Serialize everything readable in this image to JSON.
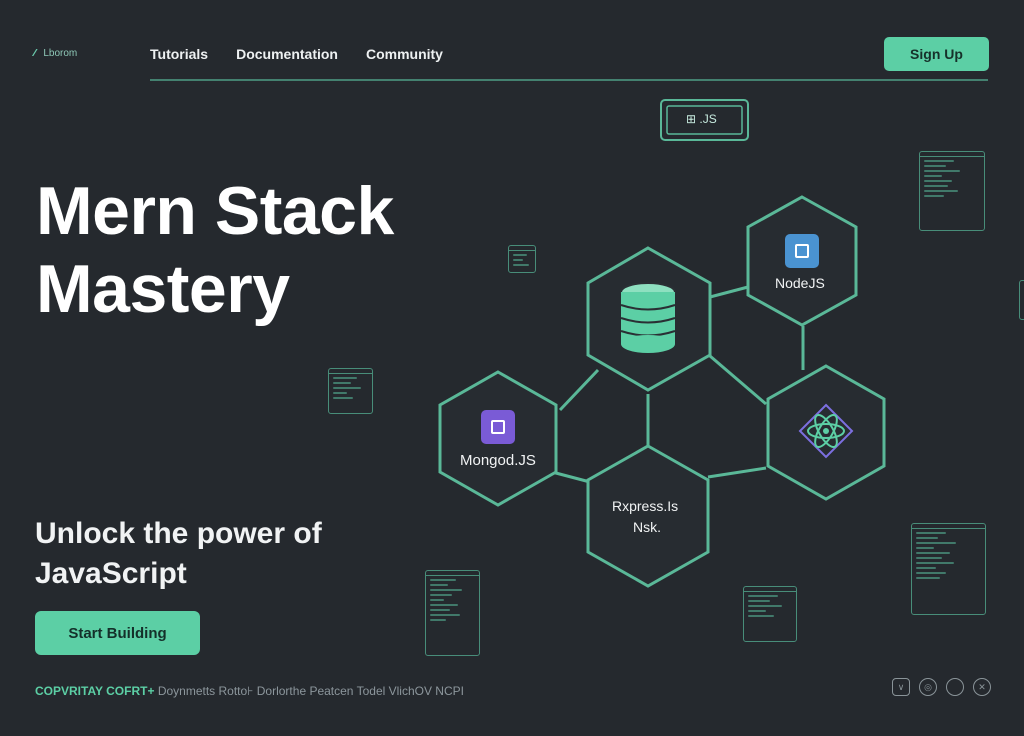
{
  "header": {
    "logo_mark": "⁄⁄",
    "logo_text": "Lborom",
    "nav": [
      "Tutorials",
      "Documentation",
      "Community"
    ],
    "signup_label": "Sign Up"
  },
  "hero": {
    "title_line1": "Mern Stack",
    "title_line2": "Mastery",
    "subtitle_line1": "Unlock the power of",
    "subtitle_line2": "JavaScript",
    "cta_label": "Start Building"
  },
  "diagram": {
    "top_window_label": "⊞ .JS",
    "node_js_label": "NodeJS",
    "mongod_label": "Mongod.JS",
    "express_label_line1": "Rxpress.Is",
    "express_label_line2": "Nsk."
  },
  "footer": {
    "copyright_highlight": "COPVRITAY COFRT+",
    "copyright_rest": "Doynmetts Rotto⊦ Dorlorthe Peatcen Todel VlichOV NCPI",
    "social_icons": [
      "chevron-down-icon",
      "circle-dot-icon",
      "circle-icon",
      "close-icon"
    ]
  },
  "colors": {
    "background": "#25292e",
    "accent": "#5ccfa5",
    "hex_stroke": "#5ab898",
    "node_badge": "#4a93d1",
    "mongo_badge": "#7a5bd6"
  }
}
